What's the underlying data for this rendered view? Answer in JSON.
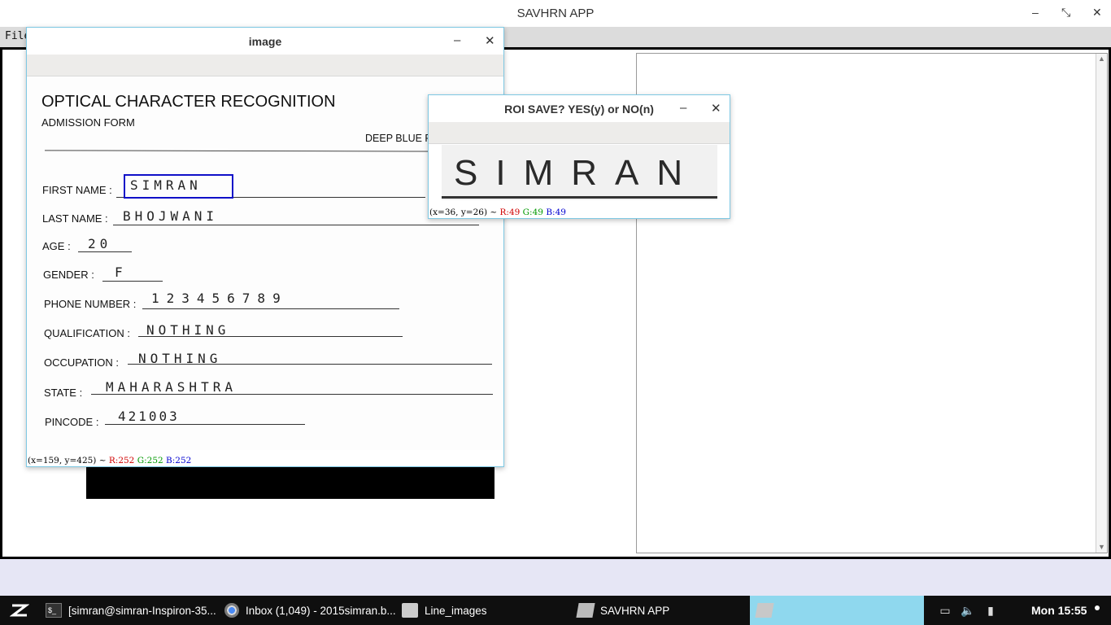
{
  "app": {
    "title": "SAVHRN APP",
    "menu_file": "File",
    "minimize_glyph": "–",
    "restore_glyph": "⤡",
    "close_glyph": "✕"
  },
  "image_window": {
    "title": "image",
    "minimize_glyph": "–",
    "close_glyph": "✕",
    "status": {
      "coords": "(x=159, y=425) ~ ",
      "r": "R:252",
      "g": "G:252",
      "b": "B:252"
    },
    "form": {
      "title": "OPTICAL CHARACTER RECOGNITION",
      "subtitle": "ADMISSION FORM",
      "deep_blue": "DEEP BLUE F",
      "fields": [
        {
          "label": "FIRST NAME :",
          "value": "SIMRAN"
        },
        {
          "label": "LAST NAME :",
          "value": "BHOJWANI"
        },
        {
          "label": "AGE :",
          "value": "20"
        },
        {
          "label": "GENDER :",
          "value": "F"
        },
        {
          "label": "PHONE NUMBER :",
          "value": "123456789"
        },
        {
          "label": "QUALIFICATION :",
          "value": "NOTHING"
        },
        {
          "label": "OCCUPATION :",
          "value": "NOTHING"
        },
        {
          "label": "STATE :",
          "value": "MAHARASHTRA"
        },
        {
          "label": "PINCODE :",
          "value": "421003"
        }
      ]
    }
  },
  "roi_window": {
    "title": "ROI SAVE? YES(y) or NO(n)",
    "minimize_glyph": "–",
    "close_glyph": "✕",
    "roi_text": "SIMRAN",
    "status": {
      "coords": "(x=36, y=26) ~ ",
      "r": "R:49",
      "g": "G:49",
      "b": "B:49"
    }
  },
  "taskbar": {
    "items": [
      {
        "label": "[simran@simran-Inspiron-35...",
        "icon": "terminal-icon"
      },
      {
        "label": "Inbox (1,049) - 2015simran.b...",
        "icon": "chrome-icon"
      },
      {
        "label": "Line_images",
        "icon": "folder-icon"
      },
      {
        "label": "SAVHRN APP",
        "icon": "app-icon"
      }
    ],
    "clock": "Mon 15:55",
    "active_color": "#8fd8ee"
  }
}
